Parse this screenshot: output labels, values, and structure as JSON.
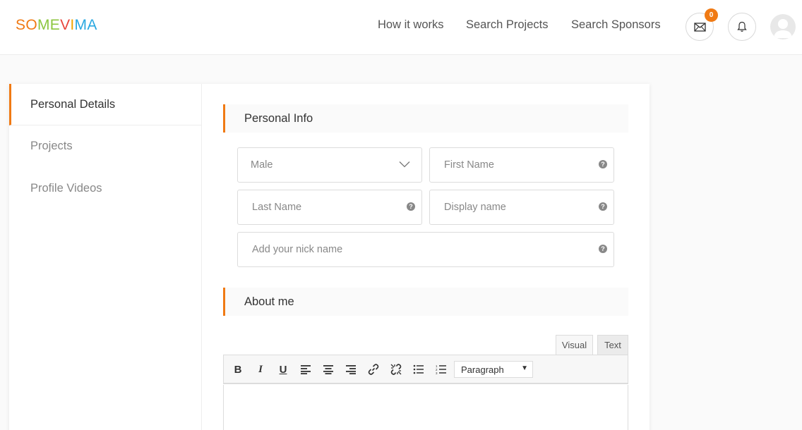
{
  "header": {
    "logo_letters": [
      {
        "char": "S",
        "color": "#f07a14"
      },
      {
        "char": "O",
        "color": "#f07a14"
      },
      {
        "char": "M",
        "color": "#8cc63f"
      },
      {
        "char": "E",
        "color": "#8cc63f"
      },
      {
        "char": "V",
        "color": "#e8453c"
      },
      {
        "char": "I",
        "color": "#f0a500"
      },
      {
        "char": "M",
        "color": "#29a8e0"
      },
      {
        "char": "A",
        "color": "#29a8e0"
      }
    ],
    "nav": {
      "how": "How it works",
      "projects": "Search Projects",
      "sponsors": "Search Sponsors"
    },
    "messages_badge": "0",
    "accent_color": "#f07a14"
  },
  "sidebar": {
    "items": [
      {
        "label": "Personal Details"
      },
      {
        "label": "Projects"
      },
      {
        "label": "Profile Videos"
      }
    ]
  },
  "personal_info": {
    "title": "Personal Info",
    "gender_value": "Male",
    "first_name_placeholder": "First Name",
    "last_name_placeholder": "Last Name",
    "display_name_placeholder": "Display name",
    "nickname_placeholder": "Add your nick name",
    "help_glyph": "?"
  },
  "about": {
    "title": "About me",
    "tabs": {
      "visual": "Visual",
      "text": "Text"
    },
    "toolbar": {
      "bold": "B",
      "italic": "I",
      "underline": "U",
      "format_value": "Paragraph",
      "format_arrow": "▼"
    }
  }
}
